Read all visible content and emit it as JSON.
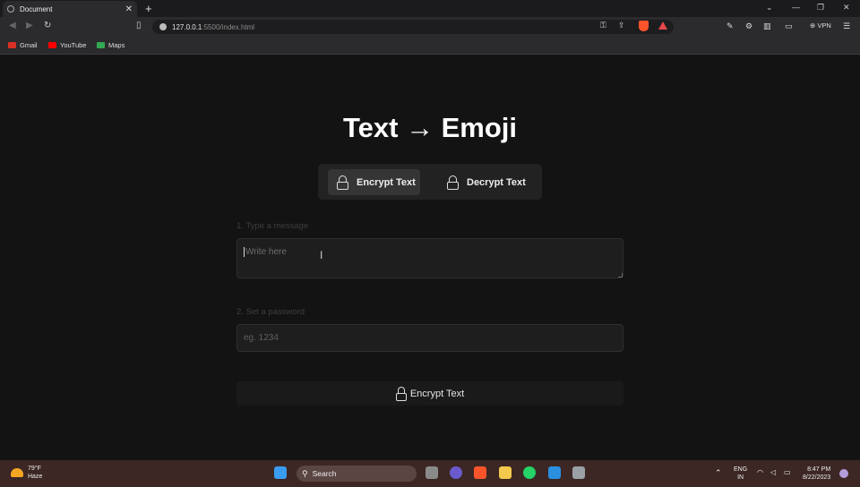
{
  "browser": {
    "tab_title": "Document",
    "tab_close": "✕",
    "new_tab": "+",
    "url_host": "127.0.0.1",
    "url_path": ":5500/index.html",
    "vpn_label": "VPN",
    "bookmarks": [
      {
        "label": "Gmail",
        "icon": "gmail-icon",
        "color": "#d93025"
      },
      {
        "label": "YouTube",
        "icon": "youtube-icon",
        "color": "#ff0000"
      },
      {
        "label": "Maps",
        "icon": "maps-icon",
        "color": "#34a853"
      }
    ]
  },
  "page": {
    "title": "Text → Emoji",
    "modes": [
      {
        "label": "Encrypt Text",
        "active": true
      },
      {
        "label": "Decrypt Text",
        "active": false
      }
    ],
    "message_label": "1. Type a message",
    "message_placeholder": "Write here",
    "password_label": "2. Set a password",
    "password_placeholder": "eg. 1234",
    "submit_label": "Encrypt Text"
  },
  "taskbar": {
    "weather_temp": "79°F",
    "weather_desc": "Haze",
    "search_label": "Search",
    "lang_top": "ENG",
    "lang_bottom": "IN",
    "time": "8:47 PM",
    "date": "8/22/2023"
  },
  "colors": {
    "background": "#131313",
    "accent_brave": "#fb542b",
    "taskbar": "#3c2724"
  }
}
